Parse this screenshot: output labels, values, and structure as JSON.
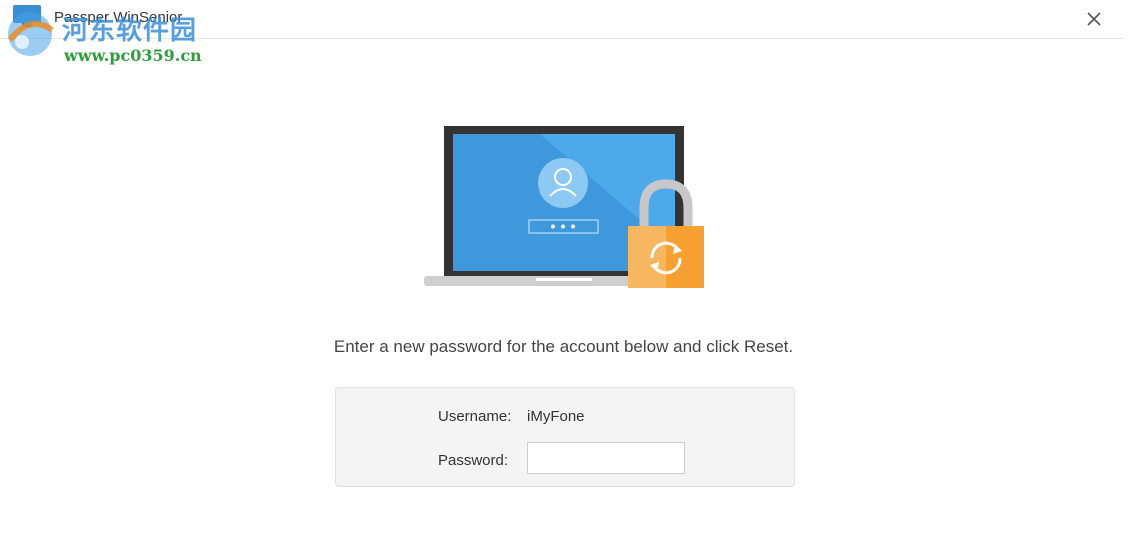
{
  "window": {
    "title": "Passper WinSenior",
    "close_icon": "close-icon",
    "app_icon": "passper-app-icon"
  },
  "watermark": {
    "site_name": "河东软件园",
    "url": "www.pc0359.cn"
  },
  "illustration": {
    "icons": [
      "laptop-icon",
      "user-avatar-icon",
      "lock-reset-icon"
    ],
    "colors": {
      "screen": "#4da9ea",
      "lock_orange": "#f5a030",
      "lock_shackle": "#c8c8c8"
    }
  },
  "main": {
    "instruction": "Enter a new password for the account below and click Reset."
  },
  "form": {
    "username_label": "Username:",
    "username_value": "iMyFone",
    "password_label": "Password:",
    "password_value": "",
    "password_placeholder": ""
  }
}
